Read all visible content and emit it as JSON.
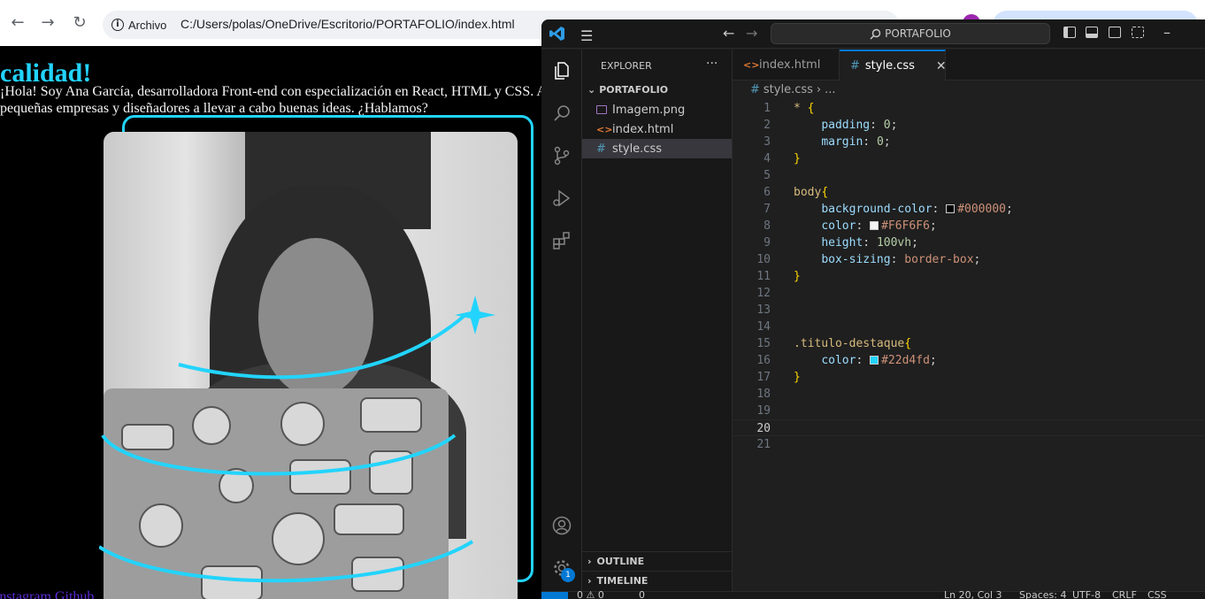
{
  "browser": {
    "back_icon": "arrow-left-icon",
    "forward_icon": "arrow-right-icon",
    "reload_icon": "reload-icon",
    "site_chip_label": "Archivo",
    "url": "C:/Users/polas/OneDrive/Escritorio/PORTAFOLIO/index.html"
  },
  "page": {
    "heading_highlight": "calidad!",
    "paragraph": "¡Hola! Soy Ana García, desarrolladora Front-end con especialización en React, HTML y CSS. Ayudo a pequeñas empresas y diseñadores a llevar a cabo buenas ideas. ¿Hablamos?",
    "links": [
      "Instagram",
      "Github"
    ],
    "colors": {
      "background": "#000000",
      "text": "#F6F6F6",
      "accent": "#22d4fd"
    }
  },
  "vscode": {
    "command_center": "PORTAFOLIO",
    "explorer_title": "EXPLORER",
    "folder": "PORTAFOLIO",
    "files": [
      {
        "name": "Imagem.png",
        "type": "png"
      },
      {
        "name": "index.html",
        "type": "html"
      },
      {
        "name": "style.css",
        "type": "css",
        "selected": true
      }
    ],
    "sections": [
      "OUTLINE",
      "TIMELINE"
    ],
    "tabs": [
      {
        "label": "index.html",
        "type": "html",
        "active": false
      },
      {
        "label": "style.css",
        "type": "css",
        "active": true
      }
    ],
    "breadcrumb": [
      "style.css",
      "..."
    ],
    "settings_badge": "1",
    "current_line": 20,
    "code_lines": [
      "* {",
      "    padding: 0;",
      "    margin: 0;",
      "}",
      "",
      "body{",
      "    background-color: #000000;",
      "    color: #F6F6F6;",
      "    height: 100vh;",
      "    box-sizing: border-box;",
      "}",
      "",
      "",
      "",
      ".titulo-destaque{",
      "    color: #22d4fd;",
      "}",
      "",
      "",
      "",
      ""
    ],
    "status": {
      "ln_col": "Ln 20, Col 3",
      "spaces": "Spaces: 4",
      "encoding": "UTF-8",
      "eol": "CRLF",
      "lang": "CSS",
      "problems": "0 ⚠ 0",
      "ports": "0"
    }
  }
}
